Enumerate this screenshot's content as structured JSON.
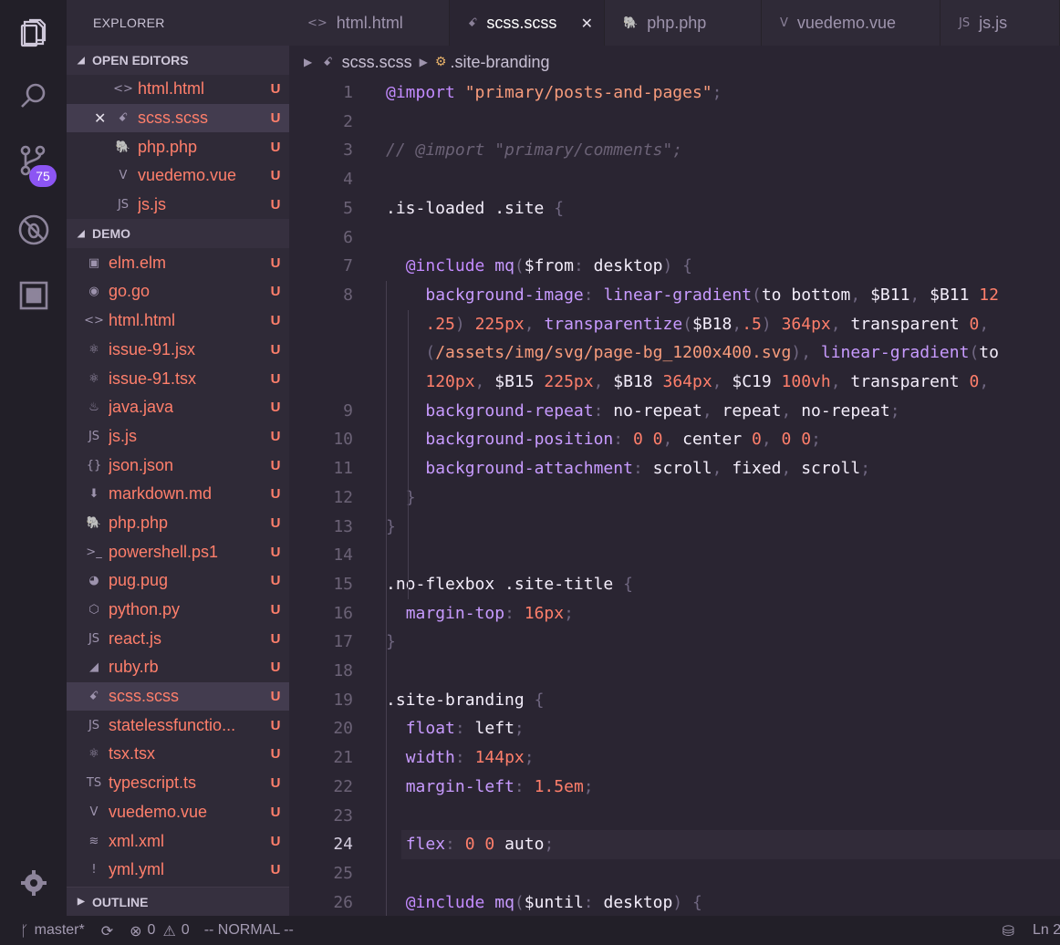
{
  "sidebar": {
    "title": "EXPLORER",
    "open_editors": {
      "label": "OPEN EDITORS",
      "items": [
        {
          "name": "html.html",
          "icon": "<>",
          "status": "U",
          "selected": false,
          "close": false
        },
        {
          "name": "scss.scss",
          "icon": "ꗃ",
          "status": "U",
          "selected": true,
          "close": true
        },
        {
          "name": "php.php",
          "icon": "🐘",
          "status": "U",
          "selected": false,
          "close": false
        },
        {
          "name": "vuedemo.vue",
          "icon": "V",
          "status": "U",
          "selected": false,
          "close": false
        },
        {
          "name": "js.js",
          "icon": "JS",
          "status": "U",
          "selected": false,
          "close": false
        }
      ]
    },
    "demo": {
      "label": "DEMO",
      "items": [
        {
          "name": "elm.elm",
          "icon": "▣",
          "status": "U"
        },
        {
          "name": "go.go",
          "icon": "◉",
          "status": "U"
        },
        {
          "name": "html.html",
          "icon": "<>",
          "status": "U"
        },
        {
          "name": "issue-91.jsx",
          "icon": "⚛",
          "status": "U"
        },
        {
          "name": "issue-91.tsx",
          "icon": "⚛",
          "status": "U"
        },
        {
          "name": "java.java",
          "icon": "♨",
          "status": "U"
        },
        {
          "name": "js.js",
          "icon": "JS",
          "status": "U"
        },
        {
          "name": "json.json",
          "icon": "{}",
          "status": "U"
        },
        {
          "name": "markdown.md",
          "icon": "⬇",
          "status": "U"
        },
        {
          "name": "php.php",
          "icon": "🐘",
          "status": "U"
        },
        {
          "name": "powershell.ps1",
          "icon": ">_",
          "status": "U"
        },
        {
          "name": "pug.pug",
          "icon": "◕",
          "status": "U"
        },
        {
          "name": "python.py",
          "icon": "⬡",
          "status": "U"
        },
        {
          "name": "react.js",
          "icon": "JS",
          "status": "U"
        },
        {
          "name": "ruby.rb",
          "icon": "◢",
          "status": "U"
        },
        {
          "name": "scss.scss",
          "icon": "ꗃ",
          "status": "U",
          "selected": true
        },
        {
          "name": "statelessfunctio...",
          "icon": "JS",
          "status": "U"
        },
        {
          "name": "tsx.tsx",
          "icon": "⚛",
          "status": "U"
        },
        {
          "name": "typescript.ts",
          "icon": "TS",
          "status": "U"
        },
        {
          "name": "vuedemo.vue",
          "icon": "V",
          "status": "U"
        },
        {
          "name": "xml.xml",
          "icon": "≋",
          "status": "U"
        },
        {
          "name": "yml.yml",
          "icon": "!",
          "status": "U"
        }
      ]
    },
    "outline_label": "OUTLINE"
  },
  "activity": {
    "scm_badge": "75"
  },
  "tabs": [
    {
      "label": "html.html",
      "icon": "<>",
      "active": false
    },
    {
      "label": "scss.scss",
      "icon": "ꗃ",
      "active": true
    },
    {
      "label": "php.php",
      "icon": "🐘",
      "active": false
    },
    {
      "label": "vuedemo.vue",
      "icon": "V",
      "active": false
    },
    {
      "label": "js.js",
      "icon": "JS",
      "active": false
    }
  ],
  "breadcrumb": {
    "file": "scss.scss",
    "symbol": ".site-branding"
  },
  "editor": {
    "current_line": 24,
    "lines": [
      {
        "n": "1",
        "tokens": [
          [
            "t-kw",
            "@import"
          ],
          [
            "t-def",
            " "
          ],
          [
            "t-str",
            "\"primary/posts-and-pages\""
          ],
          [
            "t-punc",
            ";"
          ]
        ]
      },
      {
        "n": "2",
        "tokens": []
      },
      {
        "n": "3",
        "tokens": [
          [
            "t-cmt",
            "// @import \"primary/comments\";"
          ]
        ]
      },
      {
        "n": "4",
        "tokens": []
      },
      {
        "n": "5",
        "tokens": [
          [
            "t-sel",
            ".is-loaded .site "
          ],
          [
            "t-punc",
            "{"
          ]
        ]
      },
      {
        "n": "6",
        "tokens": []
      },
      {
        "n": "7",
        "tokens": [
          [
            "t-def",
            "  "
          ],
          [
            "t-kw",
            "@include"
          ],
          [
            "t-def",
            " "
          ],
          [
            "t-fn",
            "mq"
          ],
          [
            "t-punc",
            "("
          ],
          [
            "t-var",
            "$from"
          ],
          [
            "t-punc",
            ":"
          ],
          [
            "t-val",
            " desktop"
          ],
          [
            "t-punc",
            ") {"
          ]
        ]
      },
      {
        "n": "8",
        "tokens": [
          [
            "t-def",
            "    "
          ],
          [
            "t-prop",
            "background-image"
          ],
          [
            "t-punc",
            ":"
          ],
          [
            "t-val",
            " "
          ],
          [
            "t-fn",
            "linear-gradient"
          ],
          [
            "t-punc",
            "("
          ],
          [
            "t-val",
            "to bottom"
          ],
          [
            "t-punc",
            ","
          ],
          [
            "t-val",
            " $B11"
          ],
          [
            "t-punc",
            ","
          ],
          [
            "t-val",
            " $B11 "
          ],
          [
            "t-num",
            "12"
          ]
        ]
      },
      {
        "n": "",
        "tokens": [
          [
            "t-def",
            "    "
          ],
          [
            "t-num",
            ".25"
          ],
          [
            "t-punc",
            ")"
          ],
          [
            "t-val",
            " "
          ],
          [
            "t-num",
            "225px"
          ],
          [
            "t-punc",
            ","
          ],
          [
            "t-val",
            " "
          ],
          [
            "t-fn",
            "transparentize"
          ],
          [
            "t-punc",
            "("
          ],
          [
            "t-val",
            "$B18"
          ],
          [
            "t-punc",
            ","
          ],
          [
            "t-num",
            ".5"
          ],
          [
            "t-punc",
            ")"
          ],
          [
            "t-val",
            " "
          ],
          [
            "t-num",
            "364px"
          ],
          [
            "t-punc",
            ","
          ],
          [
            "t-val",
            " transparent "
          ],
          [
            "t-num",
            "0"
          ],
          [
            "t-punc",
            ","
          ]
        ]
      },
      {
        "n": "",
        "tokens": [
          [
            "t-def",
            "    "
          ],
          [
            "t-punc",
            "("
          ],
          [
            "t-str",
            "/assets/img/svg/page-bg_1200x400.svg"
          ],
          [
            "t-punc",
            ")"
          ],
          [
            "t-punc",
            ","
          ],
          [
            "t-val",
            " "
          ],
          [
            "t-fn",
            "linear-gradient"
          ],
          [
            "t-punc",
            "("
          ],
          [
            "t-val",
            "to"
          ]
        ]
      },
      {
        "n": "",
        "tokens": [
          [
            "t-def",
            "    "
          ],
          [
            "t-num",
            "120px"
          ],
          [
            "t-punc",
            ","
          ],
          [
            "t-val",
            " $B15 "
          ],
          [
            "t-num",
            "225px"
          ],
          [
            "t-punc",
            ","
          ],
          [
            "t-val",
            " $B18 "
          ],
          [
            "t-num",
            "364px"
          ],
          [
            "t-punc",
            ","
          ],
          [
            "t-val",
            " $C19 "
          ],
          [
            "t-num",
            "100vh"
          ],
          [
            "t-punc",
            ","
          ],
          [
            "t-val",
            " transparent "
          ],
          [
            "t-num",
            "0"
          ],
          [
            "t-punc",
            ","
          ]
        ]
      },
      {
        "n": "9",
        "tokens": [
          [
            "t-def",
            "    "
          ],
          [
            "t-prop",
            "background-repeat"
          ],
          [
            "t-punc",
            ":"
          ],
          [
            "t-val",
            " no-repeat"
          ],
          [
            "t-punc",
            ","
          ],
          [
            "t-val",
            " repeat"
          ],
          [
            "t-punc",
            ","
          ],
          [
            "t-val",
            " no-repeat"
          ],
          [
            "t-punc",
            ";"
          ]
        ]
      },
      {
        "n": "10",
        "tokens": [
          [
            "t-def",
            "    "
          ],
          [
            "t-prop",
            "background-position"
          ],
          [
            "t-punc",
            ":"
          ],
          [
            "t-val",
            " "
          ],
          [
            "t-num",
            "0 0"
          ],
          [
            "t-punc",
            ","
          ],
          [
            "t-val",
            " center "
          ],
          [
            "t-num",
            "0"
          ],
          [
            "t-punc",
            ","
          ],
          [
            "t-val",
            " "
          ],
          [
            "t-num",
            "0 0"
          ],
          [
            "t-punc",
            ";"
          ]
        ]
      },
      {
        "n": "11",
        "tokens": [
          [
            "t-def",
            "    "
          ],
          [
            "t-prop",
            "background-attachment"
          ],
          [
            "t-punc",
            ":"
          ],
          [
            "t-val",
            " scroll"
          ],
          [
            "t-punc",
            ","
          ],
          [
            "t-val",
            " fixed"
          ],
          [
            "t-punc",
            ","
          ],
          [
            "t-val",
            " scroll"
          ],
          [
            "t-punc",
            ";"
          ]
        ]
      },
      {
        "n": "12",
        "tokens": [
          [
            "t-def",
            "  "
          ],
          [
            "t-punc",
            "}"
          ]
        ]
      },
      {
        "n": "13",
        "tokens": [
          [
            "t-punc",
            "}"
          ]
        ]
      },
      {
        "n": "14",
        "tokens": []
      },
      {
        "n": "15",
        "tokens": [
          [
            "t-sel",
            ".no-flexbox .site-title "
          ],
          [
            "t-punc",
            "{"
          ]
        ]
      },
      {
        "n": "16",
        "tokens": [
          [
            "t-def",
            "  "
          ],
          [
            "t-prop",
            "margin-top"
          ],
          [
            "t-punc",
            ":"
          ],
          [
            "t-val",
            " "
          ],
          [
            "t-num",
            "16px"
          ],
          [
            "t-punc",
            ";"
          ]
        ]
      },
      {
        "n": "17",
        "tokens": [
          [
            "t-punc",
            "}"
          ]
        ]
      },
      {
        "n": "18",
        "tokens": []
      },
      {
        "n": "19",
        "tokens": [
          [
            "t-sel",
            ".site-branding "
          ],
          [
            "t-punc",
            "{"
          ]
        ]
      },
      {
        "n": "20",
        "tokens": [
          [
            "t-def",
            "  "
          ],
          [
            "t-prop",
            "float"
          ],
          [
            "t-punc",
            ":"
          ],
          [
            "t-val",
            " left"
          ],
          [
            "t-punc",
            ";"
          ]
        ]
      },
      {
        "n": "21",
        "tokens": [
          [
            "t-def",
            "  "
          ],
          [
            "t-prop",
            "width"
          ],
          [
            "t-punc",
            ":"
          ],
          [
            "t-val",
            " "
          ],
          [
            "t-num",
            "144px"
          ],
          [
            "t-punc",
            ";"
          ]
        ]
      },
      {
        "n": "22",
        "tokens": [
          [
            "t-def",
            "  "
          ],
          [
            "t-prop",
            "margin-left"
          ],
          [
            "t-punc",
            ":"
          ],
          [
            "t-val",
            " "
          ],
          [
            "t-num",
            "1.5em"
          ],
          [
            "t-punc",
            ";"
          ]
        ]
      },
      {
        "n": "23",
        "tokens": []
      },
      {
        "n": "24",
        "tokens": [
          [
            "t-def",
            "  "
          ],
          [
            "t-prop",
            "flex"
          ],
          [
            "t-punc",
            ":"
          ],
          [
            "t-val",
            " "
          ],
          [
            "t-num",
            "0 0"
          ],
          [
            "t-val",
            " auto"
          ],
          [
            "t-punc",
            ";"
          ]
        ]
      },
      {
        "n": "25",
        "tokens": []
      },
      {
        "n": "26",
        "tokens": [
          [
            "t-def",
            "  "
          ],
          [
            "t-kw",
            "@include"
          ],
          [
            "t-def",
            " "
          ],
          [
            "t-fn",
            "mq"
          ],
          [
            "t-punc",
            "("
          ],
          [
            "t-var",
            "$until"
          ],
          [
            "t-punc",
            ":"
          ],
          [
            "t-val",
            " desktop"
          ],
          [
            "t-punc",
            ") {"
          ]
        ]
      }
    ]
  },
  "status": {
    "branch": "master*",
    "errors": "0",
    "warnings": "0",
    "mode": "-- NORMAL --",
    "position": "Ln 2"
  }
}
